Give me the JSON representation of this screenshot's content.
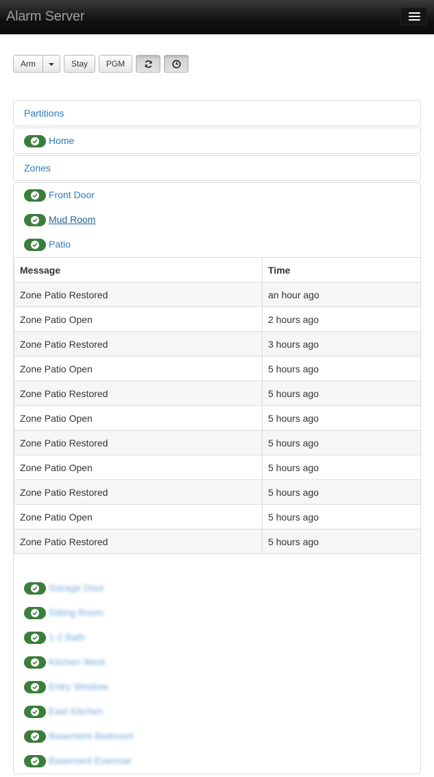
{
  "navbar": {
    "brand": "Alarm Server",
    "menu_icon": "hamburger-icon"
  },
  "toolbar": {
    "arm_label": "Arm",
    "stay_label": "Stay",
    "pgm_label": "PGM",
    "refresh_icon": "refresh-icon",
    "history_icon": "clock-icon"
  },
  "partitions": {
    "header": "Partitions",
    "items": [
      {
        "label": "Home",
        "status": "ok"
      }
    ]
  },
  "zones": {
    "header": "Zones",
    "items": [
      {
        "label": "Front Door",
        "status": "ok"
      },
      {
        "label": "Mud Room",
        "status": "ok"
      },
      {
        "label": "Patio",
        "status": "ok"
      }
    ],
    "blurred_items": [
      {
        "label": "Garage Door",
        "status": "ok"
      },
      {
        "label": "Sitting Room",
        "status": "ok"
      },
      {
        "label": "1-2 Bath",
        "status": "ok"
      },
      {
        "label": "Kitchen West",
        "status": "ok"
      },
      {
        "label": "Entry Window",
        "status": "ok"
      },
      {
        "label": "East Kitchen",
        "status": "ok"
      },
      {
        "label": "Basement Bedroom",
        "status": "ok"
      },
      {
        "label": "Basement Exercise",
        "status": "ok"
      }
    ]
  },
  "log_table": {
    "columns": [
      "Message",
      "Time"
    ],
    "rows": [
      [
        "Zone Patio Restored",
        "an hour ago"
      ],
      [
        "Zone Patio Open",
        "2 hours ago"
      ],
      [
        "Zone Patio Restored",
        "3 hours ago"
      ],
      [
        "Zone Patio Open",
        "5 hours ago"
      ],
      [
        "Zone Patio Restored",
        "5 hours ago"
      ],
      [
        "Zone Patio Open",
        "5 hours ago"
      ],
      [
        "Zone Patio Restored",
        "5 hours ago"
      ],
      [
        "Zone Patio Open",
        "5 hours ago"
      ],
      [
        "Zone Patio Restored",
        "5 hours ago"
      ],
      [
        "Zone Patio Open",
        "5 hours ago"
      ],
      [
        "Zone Patio Restored",
        "5 hours ago"
      ]
    ]
  },
  "colors": {
    "ok_badge": "#3b7d3b",
    "link": "#2a7bbf",
    "navbar": "#111111"
  }
}
